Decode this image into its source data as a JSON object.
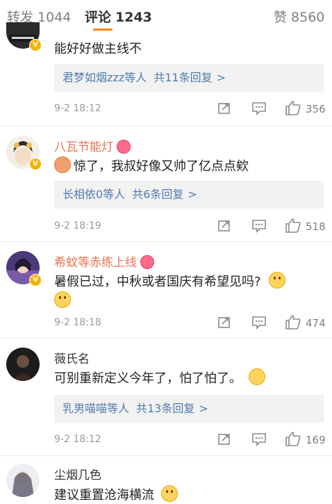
{
  "tabs": {
    "repost_label": "转发",
    "repost_count": "1044",
    "comment_label": "评论",
    "comment_count": "1243",
    "like_label": "赞",
    "like_count": "8560"
  },
  "comments": [
    {
      "username": "",
      "text": "能好好做主线不",
      "reply_users": "君梦如烟zzz",
      "reply_mid": "等人",
      "reply_count": "共11条回复",
      "reply_arrow": ">",
      "time": "9-2 18:12",
      "likes": "356"
    },
    {
      "username": "八瓦节能灯",
      "text": "惊了，我叔好像又帅了亿点点欸",
      "reply_users": "长相依0",
      "reply_mid": "等人",
      "reply_count": "共6条回复",
      "reply_arrow": ">",
      "time": "9-2 18:19",
      "likes": "518"
    },
    {
      "username": "希蚊等赤练上线",
      "text": "暑假已过，中秋或者国庆有希望见吗?",
      "time": "9-2 18:18",
      "likes": "474"
    },
    {
      "username": "薇氏名",
      "text": "可别重新定义今年了，怕了怕了。",
      "reply_users": "乳男喵喵",
      "reply_mid": "等人",
      "reply_count": "共13条回复",
      "reply_arrow": ">",
      "time": "9-2 18:12",
      "likes": "169"
    },
    {
      "username": "尘烟几色",
      "text": "建议重置沧海横流"
    }
  ],
  "colors": {
    "accent": "#ff8200",
    "link": "#507daf",
    "vip_name": "#eb7350",
    "badge": "#f3b400"
  }
}
